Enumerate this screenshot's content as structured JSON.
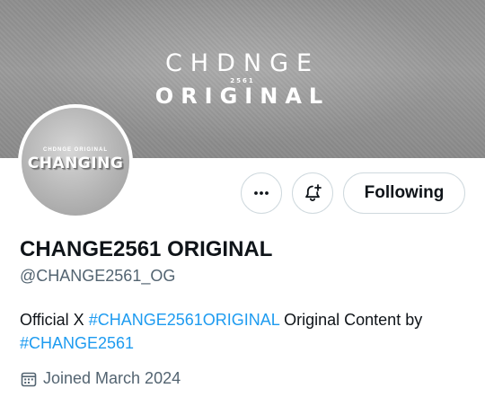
{
  "banner": {
    "logo_line1": "CHDNGE",
    "logo_year": "2561",
    "logo_line2": "ORIGINAL"
  },
  "avatar": {
    "small_text": "CHDNGE ORIGINAL",
    "big_text": "CHANGING"
  },
  "actions": {
    "more_icon": "more-horizontal-icon",
    "notify_icon": "bell-plus-icon",
    "follow_label": "Following"
  },
  "profile": {
    "name": "CHANGE2561 ORIGINAL",
    "handle": "@CHANGE2561_OG",
    "bio": {
      "part1": "Official X ",
      "tag1": "#CHANGE2561ORIGINAL",
      "part2": " Original Content by ",
      "tag2": "#CHANGE2561"
    },
    "joined": "Joined March 2024",
    "joined_icon": "calendar-icon"
  },
  "colors": {
    "link": "#1d9bf0",
    "text": "#0f1419",
    "secondary": "#536471",
    "border": "#cfd9de"
  }
}
